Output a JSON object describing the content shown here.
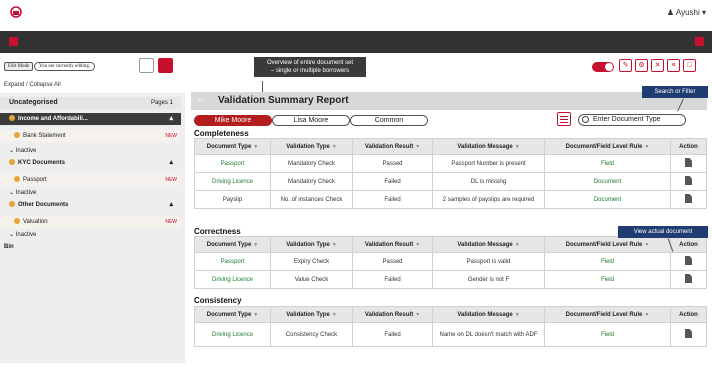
{
  "header": {
    "user_name": "Ayushi"
  },
  "toolbar": {
    "edit_mode_label": "Edit Mode",
    "editing_notice": "You are currently editing."
  },
  "callouts": {
    "overview_line1": "Overview of entire document set",
    "overview_line2": "– single or multiple borrowers",
    "search_filter": "Search or Filter",
    "view_document": "View actual document"
  },
  "sidebar": {
    "expand_collapse": "Expand / Collapse All",
    "header_label": "Uncategorised",
    "header_pages": "Pages 1",
    "groups": [
      {
        "label": "Income and Affordabili...",
        "item": "Bank Statement",
        "item_badge": "NEW",
        "inactive": "Inactive"
      },
      {
        "label": "KYC Documents",
        "item": "Passport",
        "item_badge": "NEW",
        "inactive": "Inactive"
      },
      {
        "label": "Other Documents",
        "item": "Valuation",
        "item_badge": "NEW",
        "inactive": "Inactive"
      }
    ],
    "bin_label": "Bin"
  },
  "main": {
    "title": "Validation Summary Report",
    "tabs": [
      "Mike Moore",
      "Lisa Moore",
      "Common"
    ],
    "search_placeholder": "Enter Document Type",
    "columns": [
      "Document Type",
      "Validation Type",
      "Validation Result",
      "Validation Message",
      "Document/Field Level Rule",
      "Action"
    ],
    "sections": [
      {
        "title": "Completeness",
        "rows": [
          [
            "Passport",
            "Mandatory Check",
            "Passed",
            "Passport Number is present",
            "Field"
          ],
          [
            "Driving Licence",
            "Mandatory Check",
            "Failed",
            "DL is missing",
            "Document"
          ],
          [
            "Payslip",
            "No. of instances Check",
            "Failed",
            "2 samples of payslips are required",
            "Document"
          ]
        ]
      },
      {
        "title": "Correctness",
        "rows": [
          [
            "Passport",
            "Expiry Check",
            "Passed",
            "Passport is valid",
            "Field"
          ],
          [
            "Driving Licence",
            "Value Check",
            "Failed",
            "Gender is not F",
            "Field"
          ]
        ]
      },
      {
        "title": "Consistency",
        "rows": [
          [
            "Driving Licence",
            "Consistency Check",
            "Failed",
            "Name on DL doesn't match with ADF",
            "Field"
          ]
        ]
      }
    ]
  },
  "colors": {
    "accent_red": "#c8102e",
    "dark_bar": "#323232",
    "link_green": "#1e7a2e",
    "callout_blue": "#1f3d70"
  }
}
